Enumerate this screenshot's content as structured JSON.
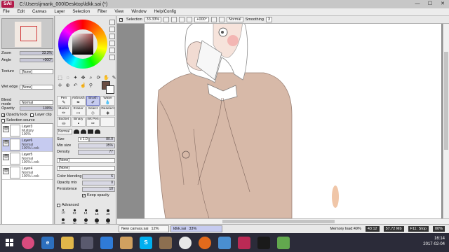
{
  "window": {
    "app_logo": "SAI",
    "title": "C:\\Users\\jmank_000\\Desktop\\ldkk.sai (*)",
    "minimize": "—",
    "maximize": "☐",
    "close": "✕"
  },
  "menu": [
    "File",
    "Edit",
    "Canvas",
    "Layer",
    "Selection",
    "Filter",
    "View",
    "Window",
    "Help/Config"
  ],
  "left_panel": {
    "zoom_label": "Zoom",
    "zoom_value": "33.3%",
    "angle_label": "Angle",
    "angle_value": "+000°",
    "texture_label": "Texture",
    "texture_value": "[None]",
    "wet_edge_label": "Wet edge",
    "wet_edge_value": "[None]",
    "blend_mode_label": "Blend mode",
    "blend_mode_value": "Normal",
    "opacity_label": "Opacity",
    "opacity_value": "100%",
    "opacity_lock": "Opacity lock",
    "layer_clip": "Layer clip",
    "selection_source": "Selection source",
    "layers": [
      {
        "name": "Layer3",
        "mode": "Multiply",
        "opacity": "100%",
        "selected": false
      },
      {
        "name": "Layer6",
        "mode": "Normal",
        "opacity": "100% Lock",
        "selected": true
      },
      {
        "name": "Layer5",
        "mode": "Normal",
        "opacity": "100% Lock",
        "selected": false
      },
      {
        "name": "Layer4",
        "mode": "Normal",
        "opacity": "100% Lock",
        "selected": false
      }
    ]
  },
  "tool_panel": {
    "tools": [
      {
        "label": "Pen",
        "glyph": "✎"
      },
      {
        "label": "Airbrush",
        "glyph": "✒"
      },
      {
        "label": "Brush",
        "glyph": "✐"
      },
      {
        "label": "Water",
        "glyph": "💧"
      },
      {
        "label": "Marker",
        "glyph": "✏"
      },
      {
        "label": "Eraser",
        "glyph": "▭"
      },
      {
        "label": "Select",
        "glyph": "◇"
      },
      {
        "label": "Deselect",
        "glyph": "◈"
      },
      {
        "label": "Bucket",
        "glyph": "⛀"
      },
      {
        "label": "Binary",
        "glyph": "▪"
      },
      {
        "label": "Ink Pen",
        "glyph": "✑"
      },
      {
        "label": "",
        "glyph": ""
      }
    ],
    "active_tool": "Brush",
    "brush_mode": "Normal",
    "size_label": "Size",
    "size_mult": "x 1.0",
    "size_value": "80.0",
    "min_size_label": "Min size",
    "min_size_value": "35%",
    "density_label": "Density",
    "density_value": "77",
    "shape_1": "[None]",
    "shape_2": "[None]",
    "color_blending_label": "Color blending",
    "color_blending_value": "6",
    "opacity_mix_label": "Opacity mix",
    "opacity_mix_value": "0",
    "persistence_label": "Persistence",
    "persistence_value": "10",
    "keep_opacity": "Keep opacity",
    "advanced": "Advanced",
    "brush_sizes": [
      "10",
      "12",
      "14",
      "16",
      "20",
      "25",
      "30",
      "35",
      "40",
      "50",
      "60",
      "70",
      "80",
      "100",
      "120",
      "160",
      "200",
      "250",
      "300",
      "350"
    ],
    "fg_color": "#6a4d43",
    "bg_color": "#ffffff"
  },
  "canvas_toolbar": {
    "selection": "Selection",
    "zoom": "33.33%",
    "angle": "+000°",
    "blend": "Normal",
    "smoothing_label": "Smoothing",
    "smoothing_value": "3"
  },
  "statusbar": {
    "docs": [
      {
        "name": "New canvas.sai",
        "zoom": "12%"
      },
      {
        "name": "ldkk.sai",
        "zoom": "33%"
      }
    ],
    "memory": "Memory load:49%",
    "time_a": "43:12",
    "mem_mb": "57.72 Mb",
    "f11": "F11: Stop",
    "pct": "00%"
  },
  "taskbar": {
    "time": "16:14",
    "date": "2017-02-04"
  }
}
